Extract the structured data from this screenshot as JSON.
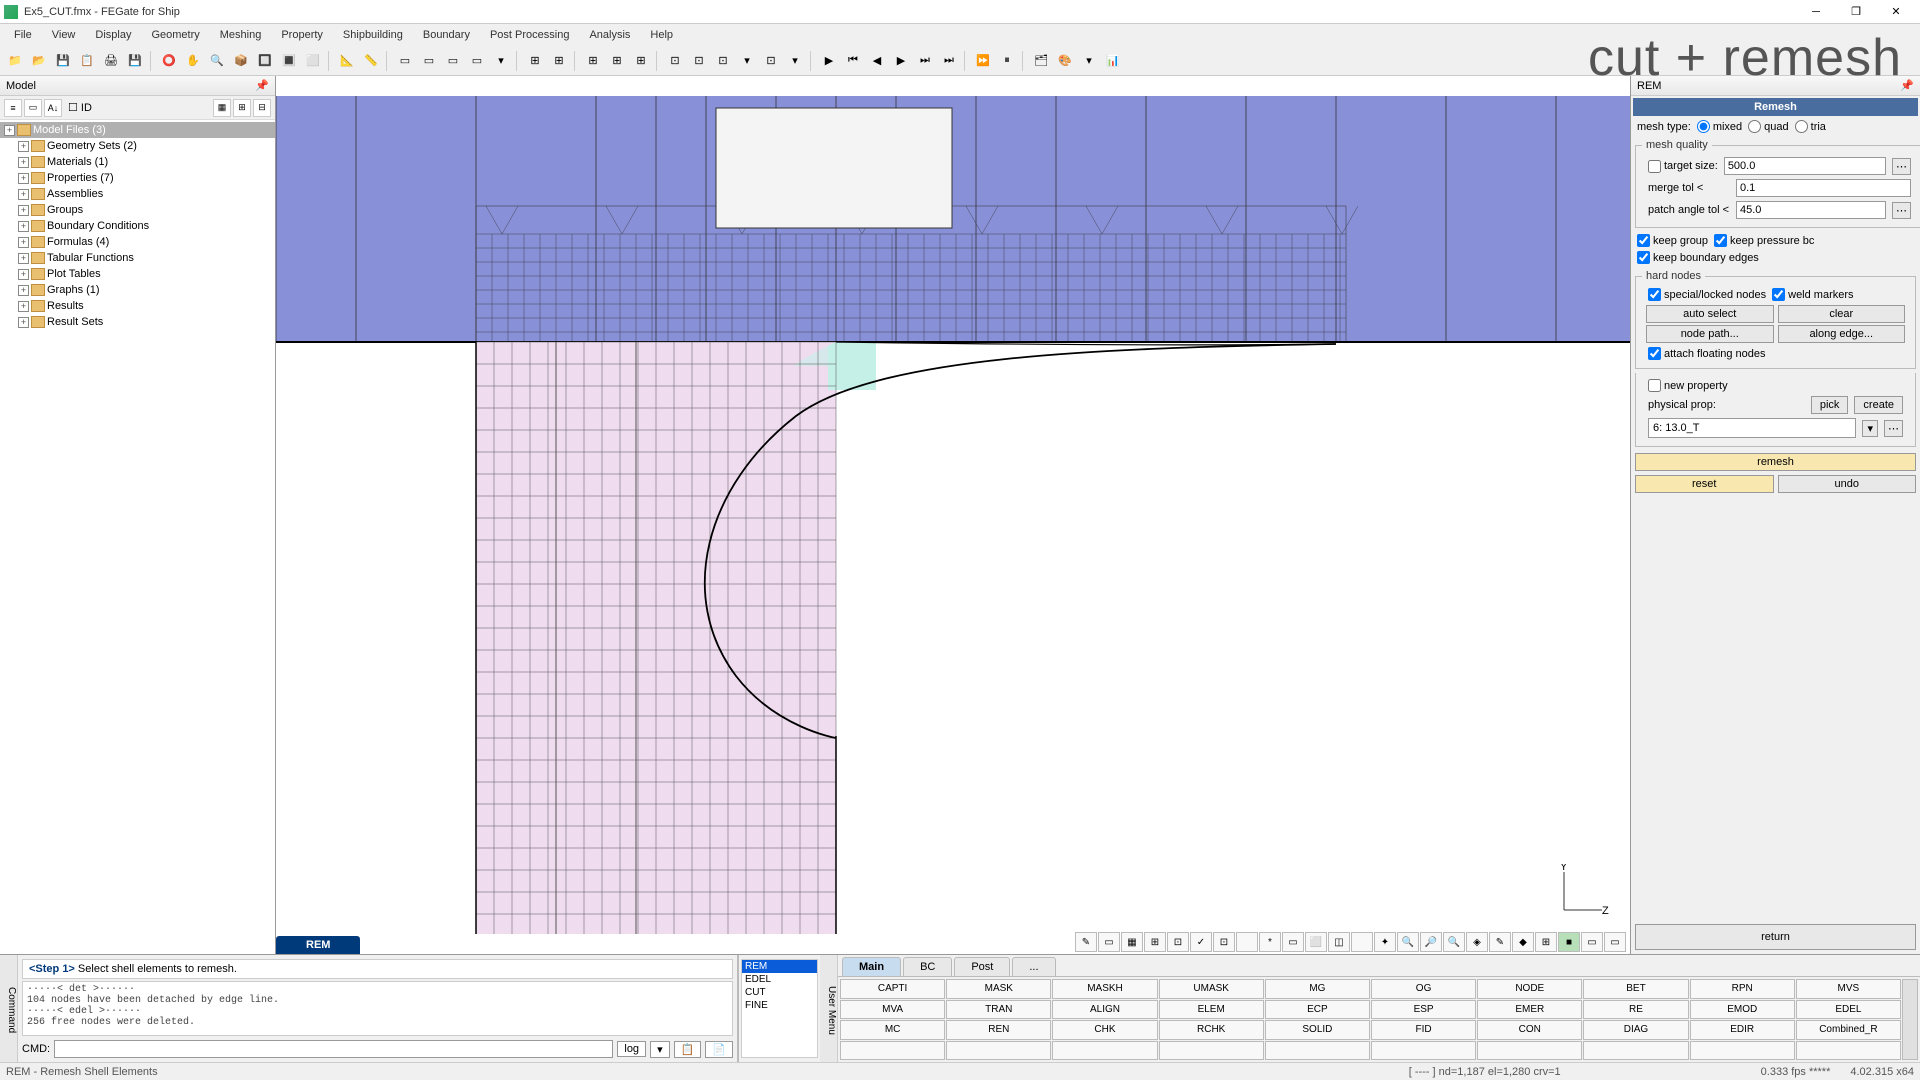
{
  "title": "Ex5_CUT.fmx - FEGate for Ship",
  "watermark": "cut + remesh",
  "menus": [
    "File",
    "View",
    "Display",
    "Geometry",
    "Meshing",
    "Property",
    "Shipbuilding",
    "Boundary",
    "Post Processing",
    "Analysis",
    "Help"
  ],
  "left_panel": {
    "title": "Model",
    "id_label": "ID",
    "nodes": [
      {
        "label": "Model Files (3)",
        "sel": true,
        "l": 0
      },
      {
        "label": "Geometry Sets (2)",
        "l": 1
      },
      {
        "label": "Materials (1)",
        "l": 1
      },
      {
        "label": "Properties (7)",
        "l": 1
      },
      {
        "label": "Assemblies",
        "l": 1
      },
      {
        "label": "Groups",
        "l": 1
      },
      {
        "label": "Boundary Conditions",
        "l": 1
      },
      {
        "label": "Formulas (4)",
        "l": 1
      },
      {
        "label": "Tabular Functions",
        "l": 1
      },
      {
        "label": "Plot Tables",
        "l": 1
      },
      {
        "label": "Graphs (1)",
        "l": 1
      },
      {
        "label": "Results",
        "l": 1
      },
      {
        "label": "Result Sets",
        "l": 1
      }
    ]
  },
  "tab": "REM",
  "axis": {
    "y": "Y",
    "z": "Z"
  },
  "rem": {
    "title": "REM",
    "header": "Remesh",
    "mesh_type_label": "mesh type:",
    "mesh_types": [
      "mixed",
      "quad",
      "tria"
    ],
    "mesh_quality": "mesh quality",
    "target_size_label": "target size:",
    "target_size": "500.0",
    "merge_tol_label": "merge tol <",
    "merge_tol": "0.1",
    "patch_angle_label": "patch angle tol <",
    "patch_angle": "45.0",
    "keep_group": "keep group",
    "keep_pressure": "keep pressure bc",
    "keep_boundary": "keep boundary edges",
    "hard_nodes": "hard nodes",
    "special_locked": "special/locked nodes",
    "weld_markers": "weld markers",
    "auto_select": "auto select",
    "clear": "clear",
    "node_path": "node path...",
    "along_edge": "along edge...",
    "attach_floating": "attach floating nodes",
    "new_property": "new property",
    "physical_prop": "physical prop:",
    "pick": "pick",
    "create": "create",
    "prop_value": "6: 13.0_T",
    "remesh": "remesh",
    "reset": "reset",
    "undo": "undo",
    "return": "return"
  },
  "prompt": {
    "step": "<Step 1>",
    "text": "Select shell elements to remesh."
  },
  "log_lines": "·····< det >······\n104 nodes have been detached by edge line.\n·····< edel >······\n256 free nodes were deleted.",
  "cmd_label": "CMD:",
  "log_btn": "log",
  "cmd_list": [
    "REM",
    "EDEL",
    "CUT",
    "FINE"
  ],
  "grid_tabs": [
    "Main",
    "BC",
    "Post",
    "..."
  ],
  "grid_btns_r1": [
    "CAPTI",
    "MASK",
    "MASKH",
    "UMASK",
    "MG",
    "OG",
    "NODE",
    "BET",
    "RPN",
    "MVS"
  ],
  "grid_btns_r2": [
    "MVA",
    "TRAN",
    "ALIGN",
    "ELEM",
    "ECP",
    "ESP",
    "EMER",
    "RE",
    "EMOD",
    "EDEL"
  ],
  "grid_btns_r3": [
    "MC",
    "REN",
    "CHK",
    "RCHK",
    "SOLID",
    "FID",
    "CON",
    "DIAG",
    "EDIR",
    "Combined_R"
  ],
  "status": {
    "hint": "REM - Remesh Shell Elements",
    "info": "[ ---- ]   nd=1,187   el=1,280   crv=1",
    "fps": "0.333 fps *****",
    "ver": "4.02.315 x64"
  },
  "side_labels": {
    "command": "Command",
    "usermenu": "User Menu"
  }
}
